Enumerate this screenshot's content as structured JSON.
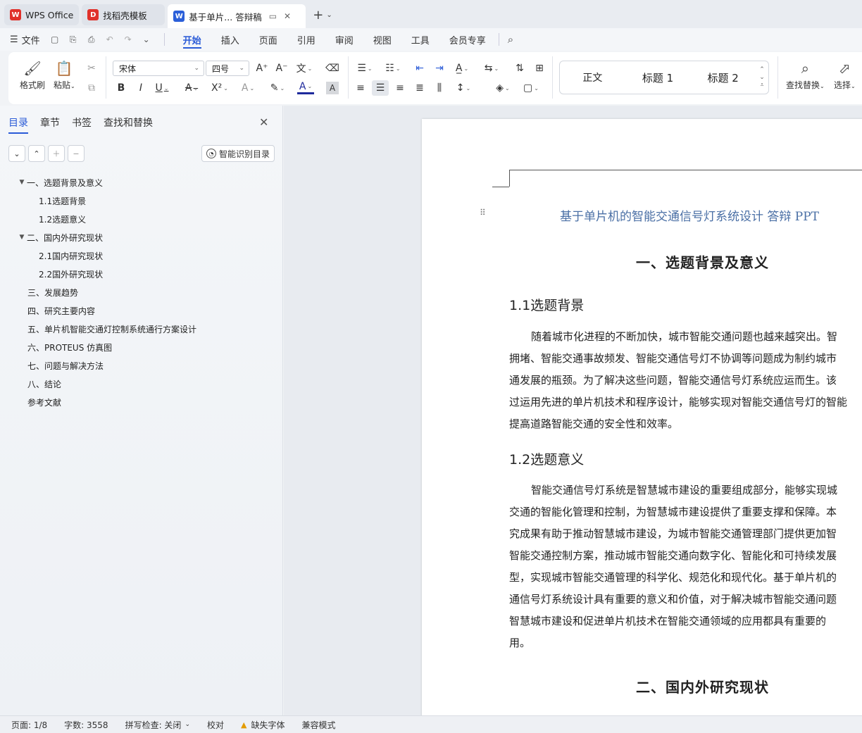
{
  "tabs": [
    {
      "label": "WPS Office",
      "icon": "wps-logo-icon",
      "color": "#e0312b"
    },
    {
      "label": "找稻壳模板",
      "icon": "docer-logo-icon",
      "color": "#e0312b"
    },
    {
      "label": "基于单片... 答辩稿",
      "icon": "word-doc-icon",
      "color": "#2b5fd9"
    }
  ],
  "menu": {
    "file": "文件",
    "tabs": [
      "开始",
      "插入",
      "页面",
      "引用",
      "审阅",
      "视图",
      "工具",
      "会员专享"
    ],
    "active_tab": "开始"
  },
  "ribbon": {
    "format_painter": "格式刷",
    "paste": "粘贴",
    "font_name": "宋体",
    "font_size": "四号",
    "styles": [
      "正文",
      "标题 1",
      "标题 2"
    ],
    "find_replace": "查找替换",
    "select": "选择"
  },
  "sidebar": {
    "tabs": [
      "目录",
      "章节",
      "书签",
      "查找和替换"
    ],
    "active_tab": "目录",
    "smart_toc": "智能识别目录",
    "toc": [
      {
        "label": "一、选题背景及意义",
        "level": 1,
        "expanded": true
      },
      {
        "label": "1.1选题背景",
        "level": 2
      },
      {
        "label": "1.2选题意义",
        "level": 2
      },
      {
        "label": "二、国内外研究现状",
        "level": 1,
        "expanded": true
      },
      {
        "label": "2.1国内研究现状",
        "level": 2
      },
      {
        "label": "2.2国外研究现状",
        "level": 2
      },
      {
        "label": "三、发展趋势",
        "level": 1
      },
      {
        "label": "四、研究主要内容",
        "level": 1
      },
      {
        "label": "五、单片机智能交通灯控制系统通行方案设计",
        "level": 1
      },
      {
        "label": "六、PROTEUS 仿真图",
        "level": 1
      },
      {
        "label": "七、问题与解决方法",
        "level": 1
      },
      {
        "label": "八、结论",
        "level": 1
      },
      {
        "label": "参考文献",
        "level": 1
      }
    ]
  },
  "document": {
    "title": "基于单片机的智能交通信号灯系统设计 答辩 PPT",
    "h1_1": "一、选题背景及意义",
    "h2_1": "1.1选题背景",
    "para1": [
      "随着城市化进程的不断加快，城市智能交通问题也越来越突出。智",
      "拥堵、智能交通事故频发、智能交通信号灯不协调等问题成为制约城市",
      "通发展的瓶颈。为了解决这些问题，智能交通信号灯系统应运而生。该",
      "过运用先进的单片机技术和程序设计，能够实现对智能交通信号灯的智能",
      "提高道路智能交通的安全性和效率。"
    ],
    "h2_2": "1.2选题意义",
    "para2": [
      "智能交通信号灯系统是智慧城市建设的重要组成部分，能够实现城",
      "交通的智能化管理和控制，为智慧城市建设提供了重要支撑和保障。本",
      "究成果有助于推动智慧城市建设，为城市智能交通管理部门提供更加智",
      "智能交通控制方案，推动城市智能交通向数字化、智能化和可持续发展",
      "型，实现城市智能交通管理的科学化、规范化和现代化。基于单片机的",
      "通信号灯系统设计具有重要的意义和价值，对于解决城市智能交通问题",
      "智慧城市建设和促进单片机技术在智能交通领域的应用都具有重要的",
      "用。"
    ],
    "h1_2": "二、国内外研究现状"
  },
  "status": {
    "page": "页面: 1/8",
    "words": "字数: 3558",
    "spell": "拼写检查: 关闭",
    "proof": "校对",
    "missing_font": "缺失字体",
    "compat": "兼容模式"
  }
}
